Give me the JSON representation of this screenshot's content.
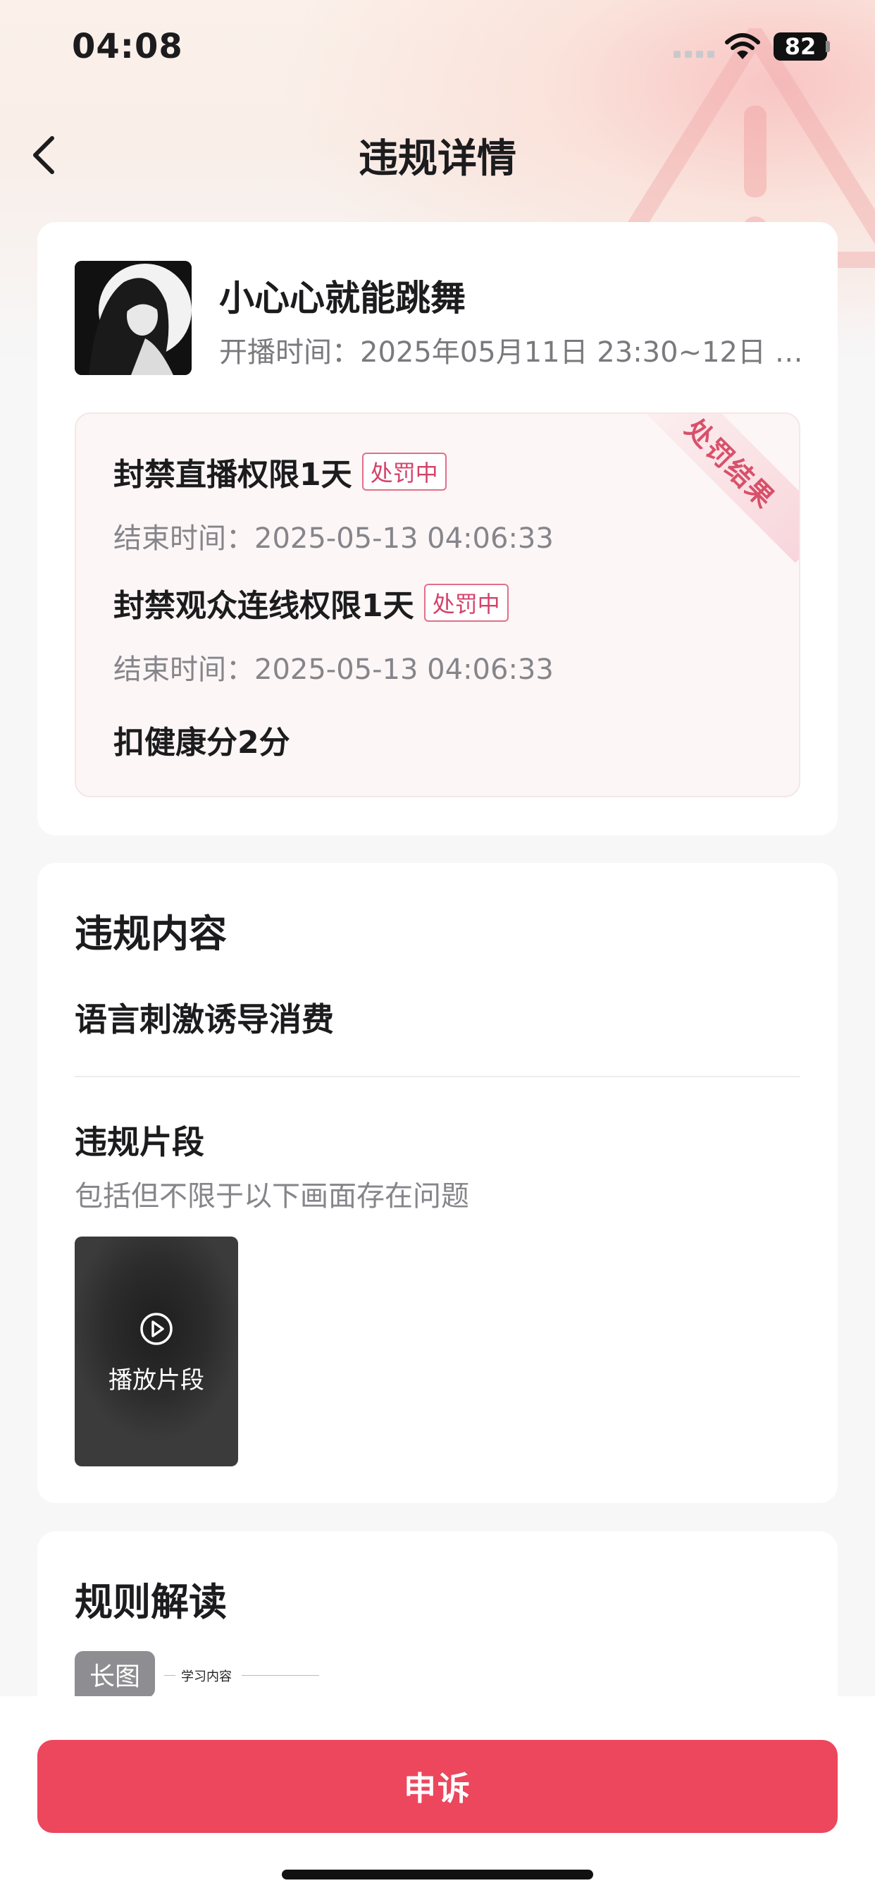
{
  "status": {
    "time": "04:08",
    "battery": "82"
  },
  "nav": {
    "title": "违规详情"
  },
  "streamer": {
    "name": "小心心就能跳舞",
    "stream_time": "开播时间：2025年05月11日 23:30~12日 04:..."
  },
  "penalty": {
    "ribbon": "处罚结果",
    "items": [
      {
        "title": "封禁直播权限1天",
        "badge": "处罚中",
        "end": "结束时间：2025-05-13 04:06:33"
      },
      {
        "title": "封禁观众连线权限1天",
        "badge": "处罚中",
        "end": "结束时间：2025-05-13 04:06:33"
      }
    ],
    "score": "扣健康分2分"
  },
  "violation": {
    "title": "违规内容",
    "content": "语言刺激诱导消费",
    "clip_title": "违规片段",
    "clip_desc": "包括但不限于以下画面存在问题",
    "clip_label": "播放片段"
  },
  "rules": {
    "title": "规则解读",
    "long_image_tag": "长图",
    "learn_text": "学习内容"
  },
  "actions": {
    "appeal": "申诉"
  },
  "colors": {
    "accent": "#ec475d",
    "badge": "#d4426a"
  }
}
